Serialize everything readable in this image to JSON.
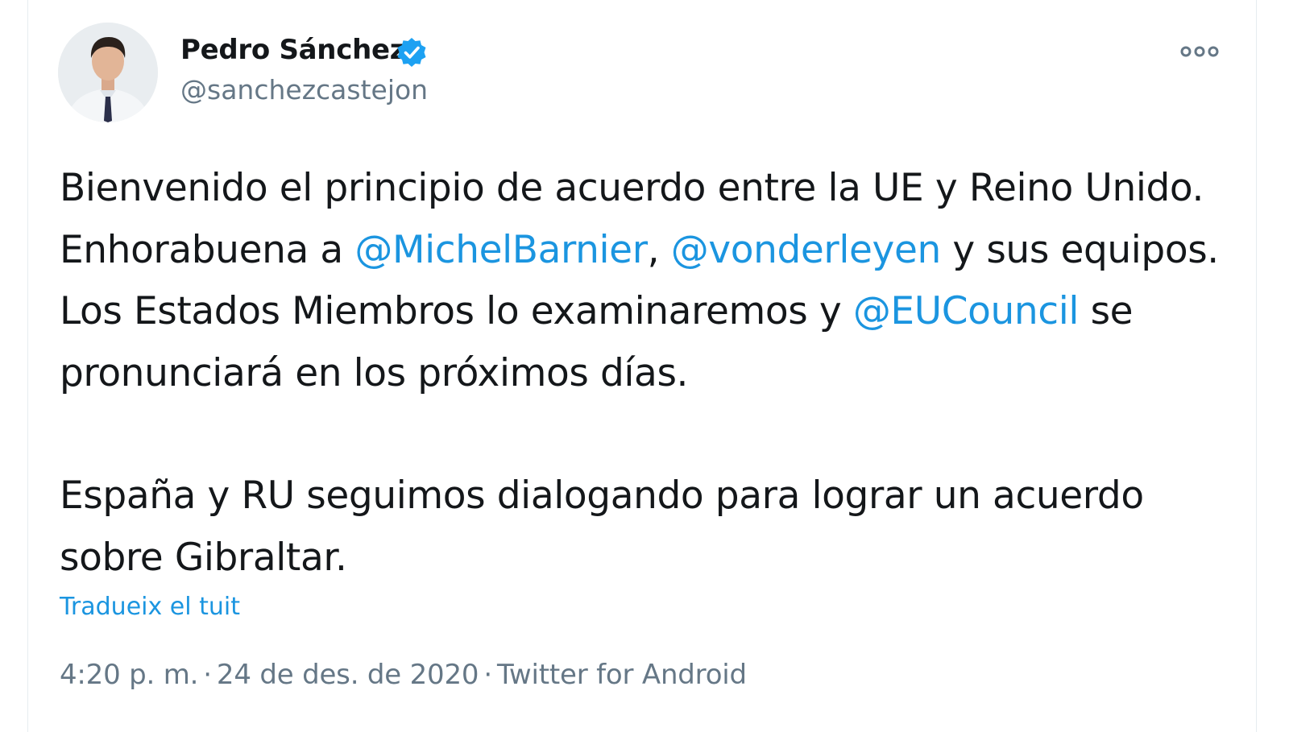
{
  "tweet": {
    "author": {
      "display_name": "Pedro Sánchez",
      "handle": "@sanchezcastejon",
      "verified": true,
      "avatar_icon": "person-avatar"
    },
    "more_icon": "more-options-icon",
    "text": {
      "p1_t1": "Bienvenido el principio de acuerdo entre la UE y Reino Unido. Enhorabuena a ",
      "mention1": "@MichelBarnier",
      "p1_t2": ", ",
      "mention2": "@vonderleyen",
      "p1_t3": " y sus equipos. Los Estados Miembros lo examinaremos y ",
      "mention3": "@EUCouncil",
      "p1_t4": " se pronunciará en los próximos días.",
      "p2": "España y RU seguimos dialogando para lograr un acuerdo sobre Gibraltar."
    },
    "translate_link": "Tradueix el tuit",
    "meta": {
      "time": "4:20 p. m.",
      "separator": "·",
      "date": "24 de des. de 2020",
      "source": "Twitter for Android"
    },
    "colors": {
      "link": "#1b95e0",
      "text": "#14171a",
      "secondary": "#657786",
      "verified_badge": "#1da1f2"
    }
  }
}
